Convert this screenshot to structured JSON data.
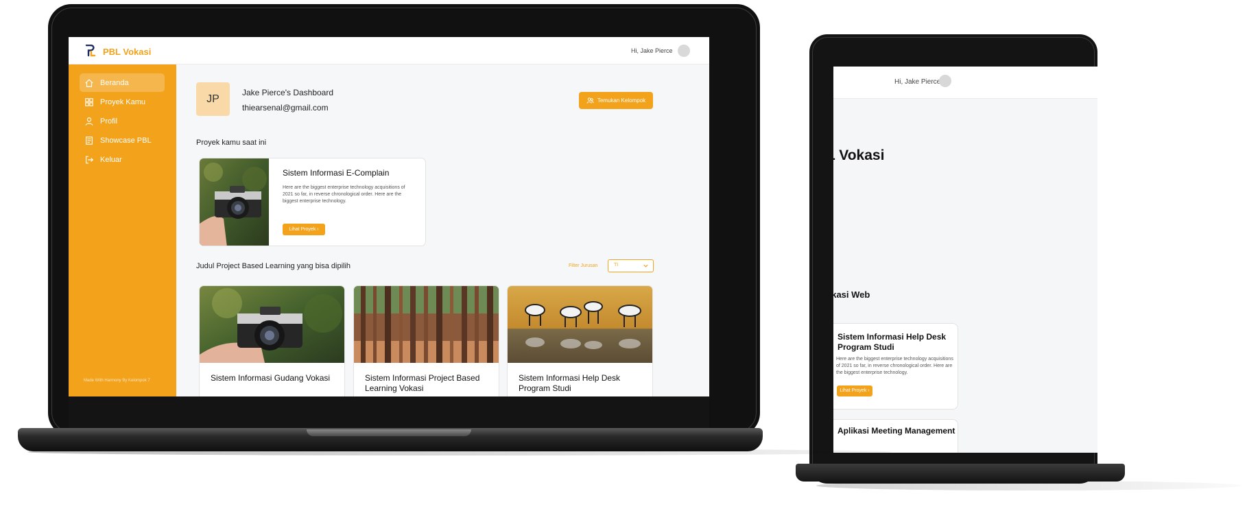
{
  "app": {
    "brand": "PBL Vokasi",
    "greeting": "Hi, Jake Pierce"
  },
  "sidebar": {
    "items": [
      {
        "label": "Beranda",
        "icon": "home-icon",
        "active": true
      },
      {
        "label": "Proyek Kamu",
        "icon": "grid-icon",
        "active": false
      },
      {
        "label": "Profil",
        "icon": "user-icon",
        "active": false
      },
      {
        "label": "Showcase PBL",
        "icon": "document-icon",
        "active": false
      },
      {
        "label": "Keluar",
        "icon": "logout-icon",
        "active": false
      }
    ],
    "footer": "Made With Harmony By Kelompok 7"
  },
  "dashboard": {
    "initials": "JP",
    "title": "Jake Pierce's Dashboard",
    "email": "thiearsenal@gmail.com",
    "find_group_label": "Temukan Kelompok"
  },
  "current_project": {
    "section_title": "Proyek kamu saat ini",
    "title": "Sistem Informasi E-Complain",
    "description": "Here are the biggest enterprise technology acquisitions of 2021 so far, in reverse chronological order. Here are the biggest enterprise technology.",
    "button_label": "Lihat Proyek ›"
  },
  "choices": {
    "section_title": "Judul Project Based Learning yang bisa dipilih",
    "filter_label": "Filter Jurusan",
    "filter_value": "TI",
    "projects": [
      {
        "title": "Sistem Informasi Gudang Vokasi",
        "image": "camera-photo"
      },
      {
        "title": "Sistem Informasi Project Based Learning Vokasi",
        "image": "forest-photo"
      },
      {
        "title": "Sistem Informasi Help Desk Program Studi",
        "image": "zebra-photo"
      }
    ]
  },
  "second_screen": {
    "greeting": "Hi, Jake Pierce",
    "brand_fragment": "L Vokasi",
    "section_fragment": "likasi Web",
    "card_title": "Sistem Informasi Help Desk Program Studi",
    "card_description": "Here are the biggest enterprise technology acquisitions of 2021 so far, in reverse chronological order. Here are the biggest enterprise technology.",
    "card_button": "Lihat Proyek ›",
    "card2_title": "Aplikasi Meeting Management"
  },
  "colors": {
    "accent": "#f2a21b",
    "accent_light": "#f9d9a7",
    "background": "#f6f7f9"
  }
}
